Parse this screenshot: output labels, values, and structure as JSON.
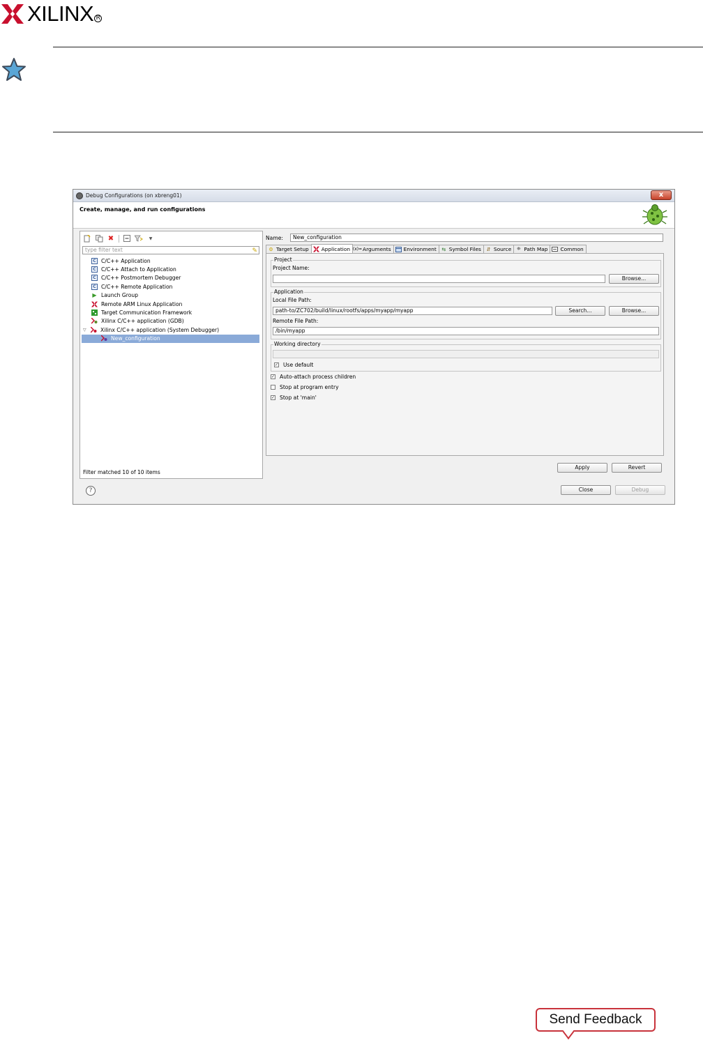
{
  "header": {
    "brand": "XILINX",
    "registered_mark": "R"
  },
  "dialog": {
    "title": "Debug Configurations  (on xbreng01)",
    "close_glyph": "x",
    "banner_title": "Create, manage, and run configurations",
    "left": {
      "filter_placeholder": "type filter text",
      "tree": [
        {
          "label": "C/C++ Application",
          "icon": "c-app-icon"
        },
        {
          "label": "C/C++ Attach to Application",
          "icon": "c-app-icon"
        },
        {
          "label": "C/C++ Postmortem Debugger",
          "icon": "c-app-icon"
        },
        {
          "label": "C/C++ Remote Application",
          "icon": "c-app-icon"
        },
        {
          "label": "Launch Group",
          "icon": "launch-group-icon"
        },
        {
          "label": "Remote ARM Linux Application",
          "icon": "xilinx-icon"
        },
        {
          "label": "Target Communication Framework",
          "icon": "tcf-icon"
        },
        {
          "label": "Xilinx C/C++ application (GDB)",
          "icon": "xilinx-debug-icon"
        },
        {
          "label": "Xilinx C/C++ application (System Debugger)",
          "icon": "xilinx-debug-icon"
        },
        {
          "label": "New_configuration",
          "icon": "xilinx-debug-icon"
        }
      ],
      "filter_status": "Filter matched 10 of 10 items"
    },
    "right": {
      "name_label": "Name:",
      "name_value": "New_configuration",
      "tabs": [
        "Target Setup",
        "Application",
        "Arguments",
        "Environment",
        "Symbol Files",
        "Source",
        "Path Map",
        "Common"
      ],
      "project_group": "Project",
      "project_name_label": "Project Name:",
      "project_name_value": "",
      "browse_label": "Browse...",
      "application_group": "Application",
      "local_path_label": "Local File Path:",
      "local_path_value": "path-to/ZC702/build/linux/rootfs/apps/myapp/myapp",
      "search_label": "Search...",
      "remote_path_label": "Remote File Path:",
      "remote_path_value": "/bin/myapp",
      "working_dir_group": "Working directory",
      "use_default_label": "Use default",
      "auto_attach_label": "Auto-attach process children",
      "stop_entry_label": "Stop at program entry",
      "stop_main_label": "Stop at 'main'",
      "apply_label": "Apply",
      "revert_label": "Revert"
    },
    "footer": {
      "help_glyph": "?",
      "close_label": "Close",
      "debug_label": "Debug"
    }
  },
  "feedback": {
    "label": "Send Feedback"
  }
}
